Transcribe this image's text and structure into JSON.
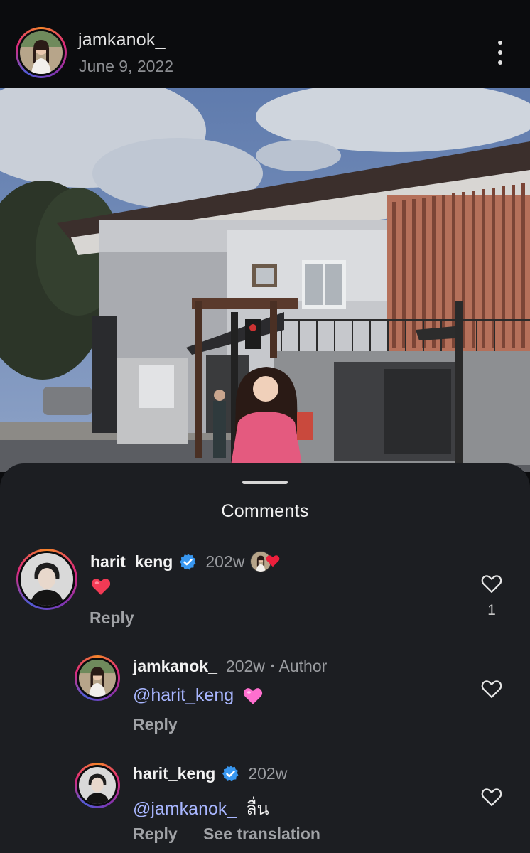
{
  "post": {
    "username": "jamkanok_",
    "date": "June 9, 2022"
  },
  "comments_sheet": {
    "title": "Comments",
    "comments": [
      {
        "username": "harit_keng",
        "verified": true,
        "time": "202w",
        "liked_by_author": true,
        "text_emoji": "heart-red",
        "reply_label": "Reply",
        "like_count": "1"
      },
      {
        "username": "jamkanok_",
        "verified": false,
        "time": "202w",
        "author_label": "Author",
        "mention": "@harit_keng",
        "text_emoji": "heart-pink",
        "reply_label": "Reply"
      },
      {
        "username": "harit_keng",
        "verified": true,
        "time": "202w",
        "mention": "@jamkanok_",
        "text": "ลื่น",
        "reply_label": "Reply",
        "see_translation": "See translation"
      }
    ]
  },
  "colors": {
    "background": "#0b0c0e",
    "sheet": "#1c1e22",
    "mention": "#a8b6ff",
    "verified": "#3897f0",
    "heart_red": "#ed1f3c",
    "heart_pink": "#ff7ad1"
  }
}
